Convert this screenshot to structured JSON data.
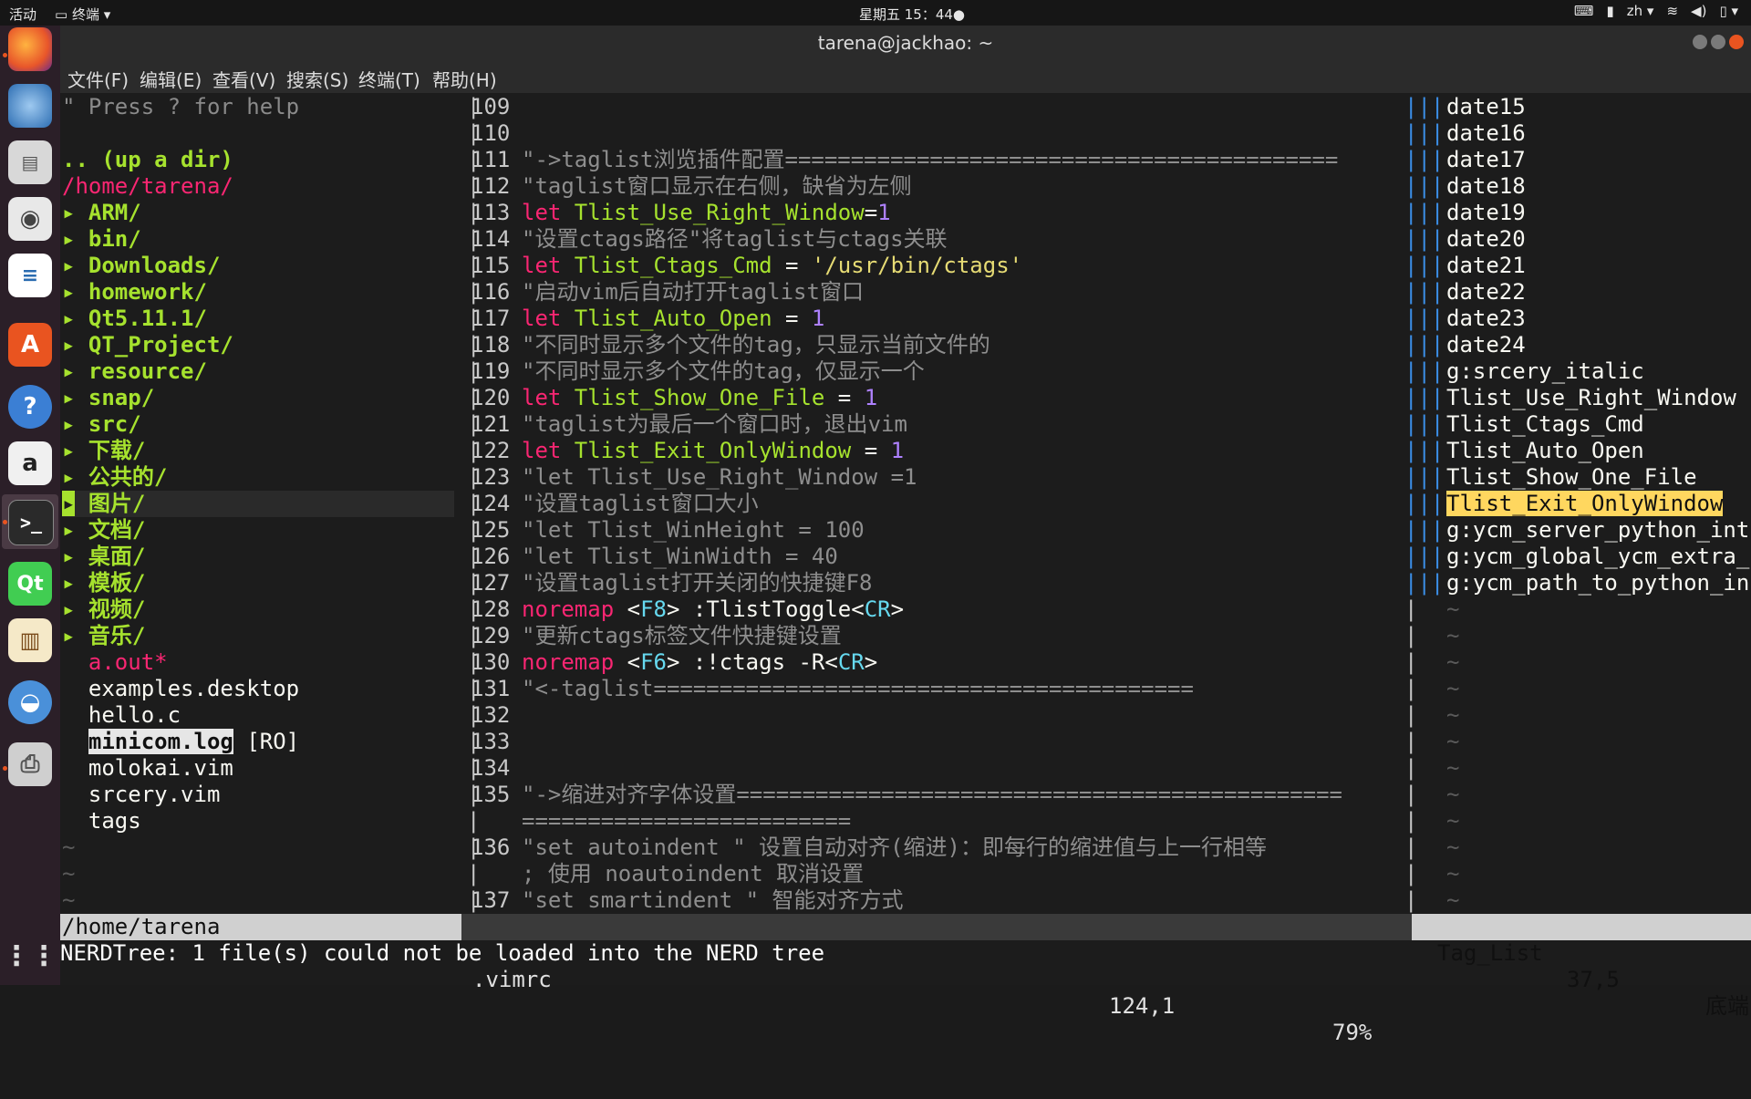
{
  "topbar": {
    "activities": "活动",
    "app_menu": "终端 ▾",
    "clock": "星期五 15：44●",
    "lang": "zh ▾"
  },
  "window": {
    "title": "tarena@jackhao: ~"
  },
  "menu": [
    "文件(F)",
    "编辑(E)",
    "查看(V)",
    "搜索(S)",
    "终端(T)",
    "帮助(H)"
  ],
  "nerdtree": {
    "help": "\" Press ? for help",
    "updir": ".. (up a dir)",
    "root": "/home/tarena/",
    "dirs": [
      "ARM/",
      "bin/",
      "Downloads/",
      "homework/",
      "Qt5.11.1/",
      "QT_Project/",
      "resource/",
      "snap/",
      "src/",
      "下载/",
      "公共的/",
      "图片/",
      "文档/",
      "桌面/",
      "模板/",
      "视频/",
      "音乐/"
    ],
    "files": [
      "a.out*",
      "examples.desktop",
      "hello.c",
      "minicom.log",
      "molokai.vim",
      "srcery.vim",
      "tags"
    ],
    "ro_tag": "[RO]",
    "dir_arrow": "▸"
  },
  "editor": {
    "lines": [
      {
        "n": "109",
        "t": ""
      },
      {
        "n": "110",
        "t": ""
      },
      {
        "n": "111",
        "t": "\"->taglist浏览插件配置=========================================="
      },
      {
        "n": "112",
        "t": "\"taglist窗口显示在右侧，缺省为左侧"
      },
      {
        "n": "113",
        "kw": "let",
        "id": " Tlist_Use_Right_Window",
        "op": "=",
        "val": "1"
      },
      {
        "n": "114",
        "t": "\"设置ctags路径\"将taglist与ctags关联"
      },
      {
        "n": "115",
        "kw": "let",
        "id": " Tlist_Ctags_Cmd ",
        "op": "= ",
        "str": "'/usr/bin/ctags'"
      },
      {
        "n": "116",
        "t": "\"启动vim后自动打开taglist窗口"
      },
      {
        "n": "117",
        "kw": "let",
        "id": " Tlist_Auto_Open ",
        "op": "= ",
        "val": "1"
      },
      {
        "n": "118",
        "t": "\"不同时显示多个文件的tag，只显示当前文件的"
      },
      {
        "n": "119",
        "t": "\"不同时显示多个文件的tag，仅显示一个"
      },
      {
        "n": "120",
        "kw": "let",
        "id": " Tlist_Show_One_File ",
        "op": "= ",
        "val": "1"
      },
      {
        "n": "121",
        "t": "\"taglist为最后一个窗口时，退出vim"
      },
      {
        "n": "122",
        "kw": "let",
        "id": " Tlist_Exit_OnlyWindow ",
        "op": "= ",
        "val": "1"
      },
      {
        "n": "123",
        "t": "\"let Tlist_Use_Right_Window =1"
      },
      {
        "n": "124",
        "t": "\"设置taglist窗口大小"
      },
      {
        "n": "125",
        "t": "\"let Tlist_WinHeight = 100"
      },
      {
        "n": "126",
        "t": "\"let Tlist_WinWidth = 40"
      },
      {
        "n": "127",
        "t": "\"设置taglist打开关闭的快捷键F8"
      },
      {
        "n": "128",
        "nm": "noremap",
        "a": " <",
        "k": "F8",
        "b": "> :TlistToggle<",
        "k2": "CR",
        "c": ">"
      },
      {
        "n": "129",
        "t": "\"更新ctags标签文件快捷键设置"
      },
      {
        "n": "130",
        "nm": "noremap",
        "a": " <",
        "k": "F6",
        "b": "> :!ctags -R<",
        "k2": "CR",
        "c": ">"
      },
      {
        "n": "131",
        "t": "\"<-taglist========================================="
      },
      {
        "n": "132",
        "t": ""
      },
      {
        "n": "133",
        "t": ""
      },
      {
        "n": "134",
        "t": ""
      },
      {
        "n": "135",
        "t": "\"->缩进对齐字体设置=============================================="
      },
      {
        "n": "",
        "t": "========================="
      },
      {
        "n": "136",
        "t": "\"set autoindent \" 设置自动对齐(缩进)：即每行的缩进值与上一行相等"
      },
      {
        "n": "",
        "t": "; 使用 noautoindent 取消设置"
      },
      {
        "n": "137",
        "t": "\"set smartindent \" 智能对齐方式"
      }
    ]
  },
  "taglist": {
    "items": [
      "date15",
      "date16",
      "date17",
      "date18",
      "date19",
      "date20",
      "date21",
      "date22",
      "date23",
      "date24",
      "g:srcery_italic",
      "Tlist_Use_Right_Window",
      "Tlist_Ctags_Cmd",
      "Tlist_Auto_Open",
      "Tlist_Show_One_File",
      "Tlist_Exit_OnlyWindow",
      "g:ycm_server_python_int",
      "g:ycm_global_ycm_extra_",
      "g:ycm_path_to_python_in"
    ],
    "selected_index": 15
  },
  "status": {
    "left": "/home/tarena",
    "file": ".vimrc",
    "pos": "124,1",
    "pct": "79%",
    "tag_title": "Tag_List",
    "tag_pos": "37,5",
    "tag_end": "底端"
  },
  "cmdline": "NERDTree: 1 file(s) could not be loaded into the NERD tree",
  "colors": {
    "accent": "#e95420",
    "green": "#a6e22e",
    "pink": "#f92672",
    "purple": "#ae81ff",
    "highlight": "#ffd75f"
  }
}
